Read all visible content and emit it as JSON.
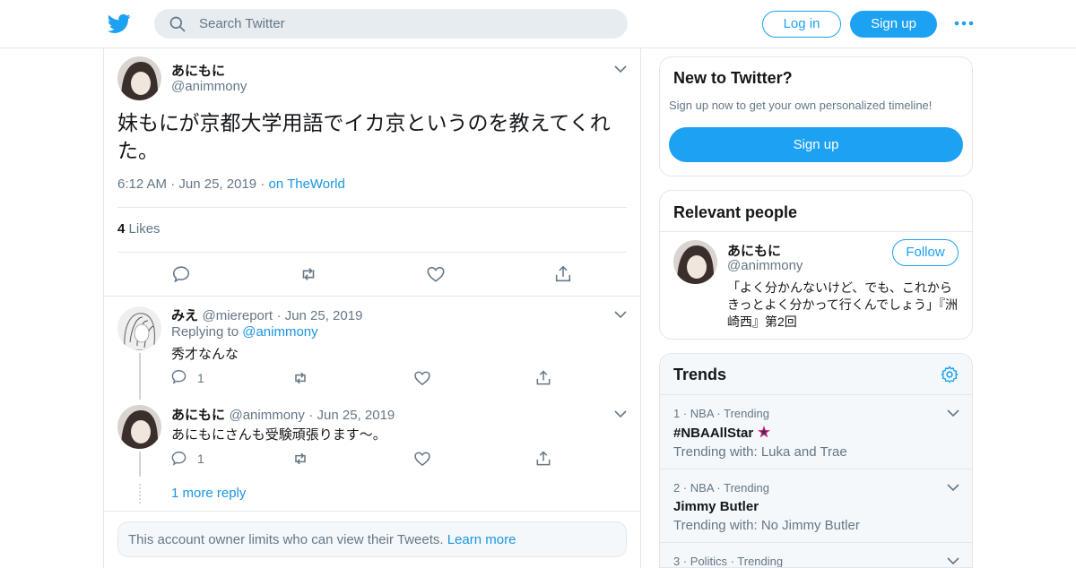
{
  "header": {
    "search_placeholder": "Search Twitter",
    "login_label": "Log in",
    "signup_label": "Sign up"
  },
  "tweet": {
    "name": "あにもに",
    "handle": "@animmony",
    "text": "妹もにが京都大学用語でイカ京というのを教えてくれた。",
    "time": "6:12 AM",
    "date": "Jun 25, 2019",
    "place": "on TheWorld",
    "likes_count": "4",
    "likes_label": "Likes"
  },
  "replies": [
    {
      "name": "みえ",
      "handle": "@miereport",
      "date": "Jun 25, 2019",
      "replying_prefix": "Replying to",
      "replying_to": "@animmony",
      "text": "秀才なんな",
      "reply_count": "1"
    },
    {
      "name": "あにもに",
      "handle": "@animmony",
      "date": "Jun 25, 2019",
      "text": "あにもにさんも受験頑張ります〜。",
      "reply_count": "1"
    }
  ],
  "more_reply": "1 more reply",
  "notice": {
    "text": "This account owner limits who can view their Tweets.",
    "link": "Learn more"
  },
  "new_to_twitter": {
    "title": "New to Twitter?",
    "subtitle": "Sign up now to get your own personalized timeline!",
    "button": "Sign up"
  },
  "relevant": {
    "title": "Relevant people",
    "name": "あにもに",
    "handle": "@animmony",
    "follow": "Follow",
    "bio": "「よく分かんないけど、でも、これからきっとよく分かって行くんでしょう」『洲崎西』第2回"
  },
  "trends": {
    "title": "Trends",
    "items": [
      {
        "context": "1 · NBA · Trending",
        "name": "#NBAAllStar",
        "with": "Trending with: Luka and Trae"
      },
      {
        "context": "2 · NBA · Trending",
        "name": "Jimmy Butler",
        "with": "Trending with: No Jimmy Butler"
      },
      {
        "context": "3 · Politics · Trending",
        "name": "",
        "with": ""
      }
    ]
  },
  "colors": {
    "accent": "#1da1f2",
    "link": "#1b95e0",
    "secondary_text": "#657786",
    "border": "#e1e8ed"
  }
}
